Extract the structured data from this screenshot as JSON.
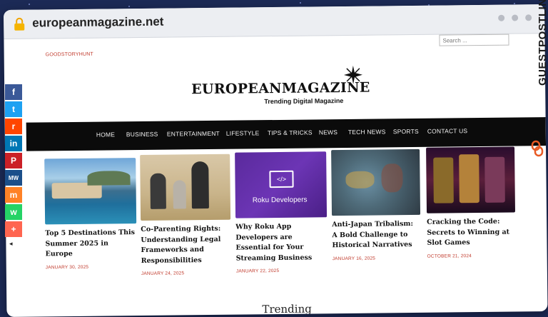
{
  "browser": {
    "url": "europeanmagazine.net"
  },
  "site": {
    "top_link": "GOODSTORYHUNT",
    "search_placeholder": "Search ...",
    "logo_title": "EUROPEANMAGAZINE",
    "tagline": "Trending Digital Magazine"
  },
  "nav": {
    "items": [
      "HOME",
      "BUSINESS",
      "ENTERTAINMENT",
      "LIFESTYLE",
      "TIPS & TRICKS",
      "NEWS",
      "TECH NEWS",
      "SPORTS",
      "CONTACT US"
    ]
  },
  "articles": [
    {
      "title": "Top 5 Destinations This Summer 2025 in Europe",
      "date": "JANUARY 30, 2025",
      "image": "coastal-town-photo"
    },
    {
      "title": "Co-Parenting Rights: Understanding Legal Frameworks and Responsibilities",
      "date": "JANUARY 24, 2025",
      "image": "family-photo"
    },
    {
      "title": "Why Roku App Developers are Essential for Your Streaming Business",
      "date": "JANUARY 22, 2025",
      "image": "roku-developers-graphic",
      "image_caption": "Roku Developers"
    },
    {
      "title": "Anti-Japan Tribalism: A Bold Challenge to Historical Narratives",
      "date": "JANUARY 16, 2025",
      "image": "map-game-photo"
    },
    {
      "title": "Cracking the Code: Secrets to Winning at Slot Games",
      "date": "OCTOBER 21, 2024",
      "image": "slot-machines-photo"
    }
  ],
  "section_heading": "Trending",
  "social": [
    {
      "name": "facebook-icon",
      "glyph": "f",
      "color": "#3b5998"
    },
    {
      "name": "twitter-icon",
      "glyph": "t",
      "color": "#1da1f2"
    },
    {
      "name": "reddit-icon",
      "glyph": "r",
      "color": "#ff4500"
    },
    {
      "name": "linkedin-icon",
      "glyph": "in",
      "color": "#0077b5"
    },
    {
      "name": "pinterest-icon",
      "glyph": "P",
      "color": "#cb2027"
    },
    {
      "name": "mewe-icon",
      "glyph": "MW",
      "color": "#1b4f8a"
    },
    {
      "name": "mix-icon",
      "glyph": "m",
      "color": "#ff8226"
    },
    {
      "name": "whatsapp-icon",
      "glyph": "w",
      "color": "#25d366"
    },
    {
      "name": "more-share-icon",
      "glyph": "+",
      "color": "#ff6550"
    }
  ],
  "brand_badge": "GUESTPOSTLINKS"
}
